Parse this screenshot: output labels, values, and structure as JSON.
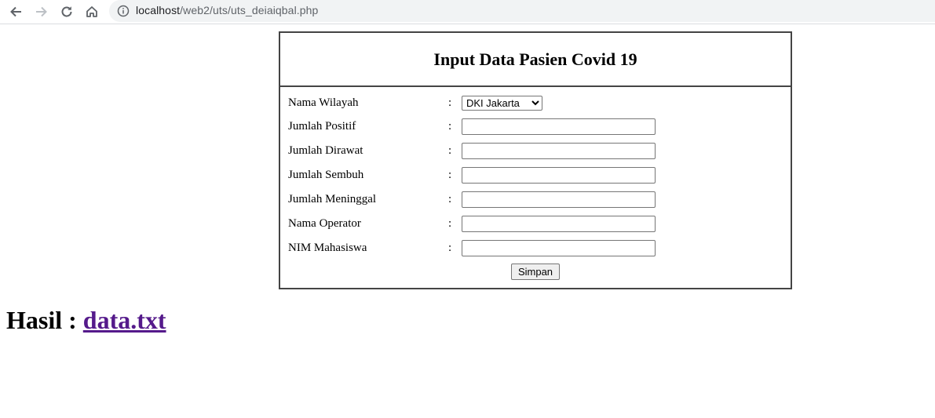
{
  "browser": {
    "url_host": "localhost",
    "url_path": "/web2/uts/uts_deiaiqbal.php"
  },
  "form": {
    "title": "Input Data Pasien Covid 19",
    "colon": ":",
    "fields": [
      {
        "label": "Nama Wilayah",
        "type": "select",
        "value": "DKI Jakarta",
        "options": [
          "DKI Jakarta"
        ]
      },
      {
        "label": "Jumlah Positif",
        "type": "text",
        "value": ""
      },
      {
        "label": "Jumlah Dirawat",
        "type": "text",
        "value": ""
      },
      {
        "label": "Jumlah Sembuh",
        "type": "text",
        "value": ""
      },
      {
        "label": "Jumlah Meninggal",
        "type": "text",
        "value": ""
      },
      {
        "label": "Nama Operator",
        "type": "text",
        "value": ""
      },
      {
        "label": "NIM Mahasiswa",
        "type": "text",
        "value": ""
      }
    ],
    "submit_label": "Simpan"
  },
  "result": {
    "label": "Hasil :",
    "link_text": "data.txt"
  },
  "colors": {
    "link_visited": "#551a8b",
    "border": "#444444",
    "omnibox_bg": "#f1f3f4"
  }
}
